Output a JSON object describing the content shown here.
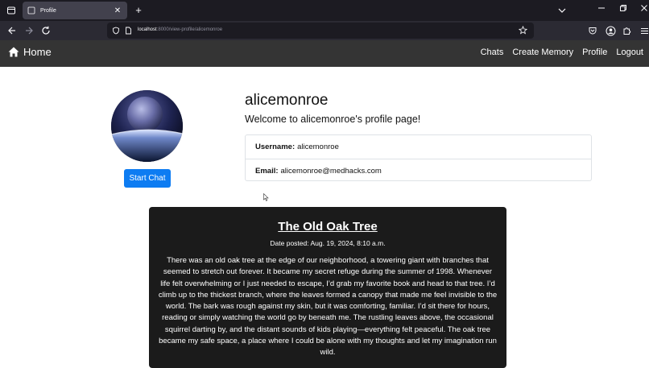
{
  "browser": {
    "tab_title": "Profile",
    "url_host": "localhost",
    "url_rest": ":8000/view-profile/alicemonroe",
    "new_tab": "+",
    "close": "✕"
  },
  "navbar": {
    "brand": "Home",
    "links": [
      "Chats",
      "Create Memory",
      "Profile",
      "Logout"
    ]
  },
  "profile": {
    "username_title": "alicemonroe",
    "welcome": "Welcome to alicemonroe's profile page!",
    "start_chat_label": "Start Chat",
    "username_label": "Username:",
    "username_value": "alicemonroe",
    "email_label": "Email:",
    "email_value": "alicemonroe@medhacks.com"
  },
  "memory": {
    "title": "The Old Oak Tree",
    "date": "Date posted: Aug. 19, 2024, 8:10 a.m.",
    "body": "There was an old oak tree at the edge of our neighborhood, a towering giant with branches that seemed to stretch out forever. It became my secret refuge during the summer of 1998. Whenever life felt overwhelming or I just needed to escape, I’d grab my favorite book and head to that tree. I’d climb up to the thickest branch, where the leaves formed a canopy that made me feel invisible to the world. The bark was rough against my skin, but it was comforting, familiar. I’d sit there for hours, reading or simply watching the world go by beneath me. The rustling leaves above, the occasional squirrel darting by, and the distant sounds of kids playing—everything felt peaceful. The oak tree became my safe space, a place where I could be alone with my thoughts and let my imagination run wild."
  }
}
